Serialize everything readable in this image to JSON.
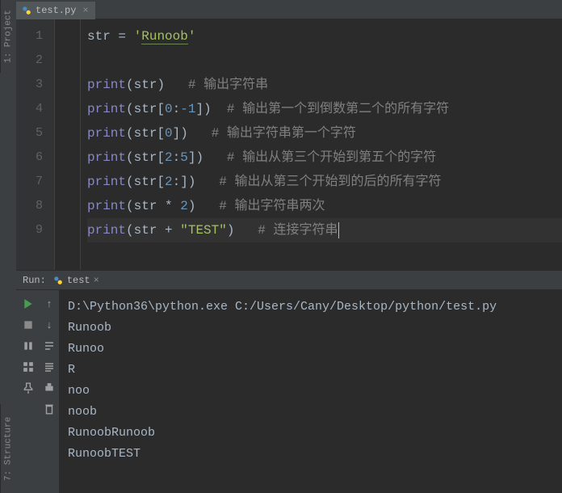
{
  "sideTabs": {
    "project": "1: Project",
    "structure": "7: Structure"
  },
  "tab": {
    "filename": "test.py"
  },
  "gutter": [
    "1",
    "2",
    "3",
    "4",
    "5",
    "6",
    "7",
    "8",
    "9"
  ],
  "code": {
    "l1": {
      "id": "str",
      "eq": " = ",
      "q1": "'",
      "s": "Runoob",
      "q2": "'"
    },
    "l3": {
      "fn": "print",
      "lp": "(",
      "id": "str",
      "rp": ")",
      "sp": "   ",
      "c": "# 输出字符串"
    },
    "l4": {
      "fn": "print",
      "lp": "(",
      "id": "str",
      "lb": "[",
      "n1": "0",
      "col": ":",
      "n2": "-1",
      "rb": "]",
      "rp": ")",
      "sp": "  ",
      "c": "# 输出第一个到倒数第二个的所有字符"
    },
    "l5": {
      "fn": "print",
      "lp": "(",
      "id": "str",
      "lb": "[",
      "n1": "0",
      "rb": "]",
      "rp": ")",
      "sp": "   ",
      "c": "# 输出字符串第一个字符"
    },
    "l6": {
      "fn": "print",
      "lp": "(",
      "id": "str",
      "lb": "[",
      "n1": "2",
      "col": ":",
      "n2": "5",
      "rb": "]",
      "rp": ")",
      "sp": "   ",
      "c": "# 输出从第三个开始到第五个的字符"
    },
    "l7": {
      "fn": "print",
      "lp": "(",
      "id": "str",
      "lb": "[",
      "n1": "2",
      "col": ":",
      "rb": "]",
      "rp": ")",
      "sp": "   ",
      "c": "# 输出从第三个开始到的后的所有字符"
    },
    "l8": {
      "fn": "print",
      "lp": "(",
      "id": "str",
      "op": " * ",
      "n": "2",
      "rp": ")",
      "sp": "   ",
      "c": "# 输出字符串两次"
    },
    "l9": {
      "fn": "print",
      "lp": "(",
      "id": "str",
      "op": " + ",
      "s": "\"TEST\"",
      "rp": ")",
      "sp": "   ",
      "c": "# 连接字符串"
    }
  },
  "run": {
    "label": "Run:",
    "config": "test",
    "output": [
      "D:\\Python36\\python.exe C:/Users/Cany/Desktop/python/test.py",
      "Runoob",
      "Runoo",
      "R",
      "noo",
      "noob",
      "RunoobRunoob",
      "RunoobTEST"
    ]
  }
}
